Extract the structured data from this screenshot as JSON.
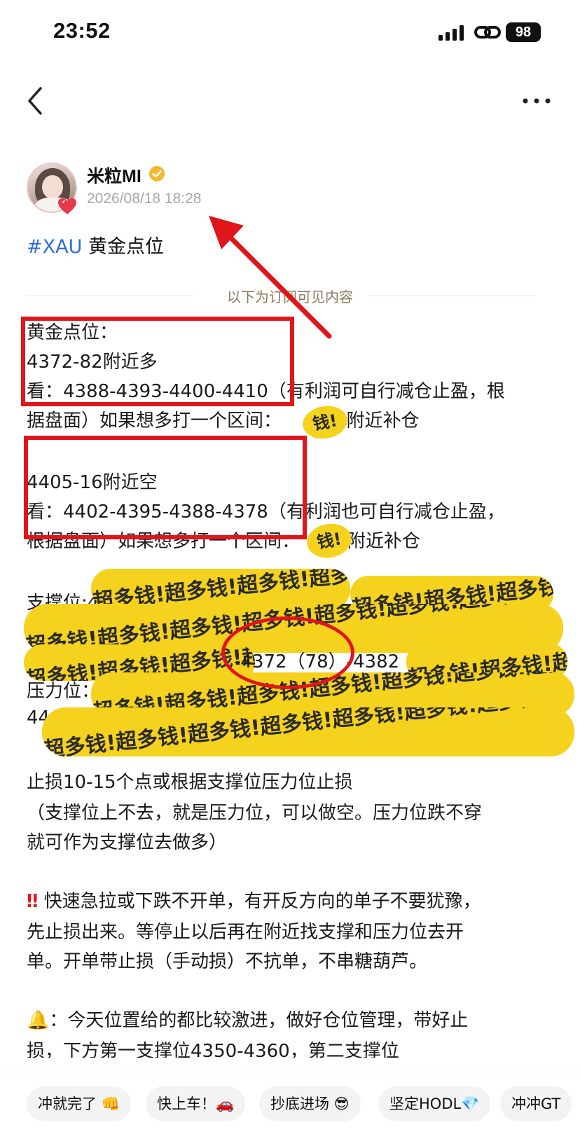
{
  "status": {
    "time": "23:52",
    "battery": "98"
  },
  "author": {
    "name": "米粒MI",
    "time": "2026/08/18 18:28"
  },
  "post": {
    "hashtag": "#XAU",
    "title": " 黄金点位"
  },
  "divider": "以下为订阅可见内容",
  "body": {
    "l1": "黄金点位：",
    "l2": "4372-82附近多",
    "l3": "看：4388-4393-4400-4410（有利润可自行减仓止盈，根",
    "l4a": "据盘面）如果想多打一个区间：",
    "l4b": "3附近补仓",
    "l5": "4405-16附近空",
    "l6": "看：4402-4395-4388-4378（有利润也可自行减仓止盈，",
    "l7a": "根据盘面）如果想多打一个区间：",
    "l7b": "附近补仓",
    "support": "支撑位:4",
    "support_visible": "-4372（78）-4382",
    "pressure": "压力位：",
    "pressure2": "44",
    "l8": "止损10-15个点或根据支撑位压力位止损",
    "l9": "（支撑位上不去，就是压力位，可以做空。压力位跌不穿",
    "l10": "就可作为支撑位去做多）",
    "l11": " 快速急拉或下跌不开单，有开反方向的单子不要犹豫，",
    "l12": "先止损出来。等停止以后再在附近找支撑和压力位去开",
    "l13": "单。开单带止损（手动损）不抗单，不串糖葫芦。",
    "l14": "：今天位置给的都比较激进，做好仓位管理，带好止",
    "l15": "损，下方第一支撑位4350-4360，第二支撑位"
  },
  "censor_text": "超多钱!超多钱!超多钱!超多钱!超多钱!超多钱!超多钱!",
  "censor_small": "钱!",
  "chips": [
    "冲就完了 👊",
    "快上车！🚗",
    "抄底进场 😎",
    "坚定HODL💎",
    "冲冲GT"
  ],
  "colors": {
    "accent": "#2f6cdc",
    "annotation_red": "#e0161b",
    "censor_yellow": "#f5d21e"
  }
}
